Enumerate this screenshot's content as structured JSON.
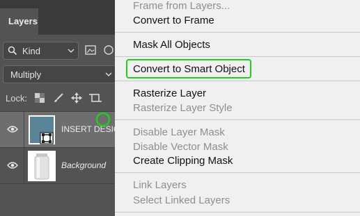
{
  "panel": {
    "tab_label": "Layers",
    "filter": {
      "selected": "Kind"
    },
    "blend_mode": {
      "selected": "Multiply"
    },
    "lock_label": "Lock:",
    "layers": [
      {
        "name": "INSERT DESIG",
        "selected": true
      },
      {
        "name": "Background",
        "selected": false
      }
    ]
  },
  "menu": {
    "items": [
      {
        "label": "Frame from Layers...",
        "enabled": false
      },
      {
        "label": "Convert to Frame",
        "enabled": true
      },
      {
        "label": "Mask All Objects",
        "enabled": true
      },
      {
        "label": "Convert to Smart Object",
        "enabled": true,
        "highlighted": true
      },
      {
        "label": "Rasterize Layer",
        "enabled": true
      },
      {
        "label": "Rasterize Layer Style",
        "enabled": false
      },
      {
        "label": "Disable Layer Mask",
        "enabled": false
      },
      {
        "label": "Disable Vector Mask",
        "enabled": false
      },
      {
        "label": "Create Clipping Mask",
        "enabled": true
      },
      {
        "label": "Link Layers",
        "enabled": false
      },
      {
        "label": "Select Linked Layers",
        "enabled": false
      }
    ]
  },
  "colors": {
    "highlight_outline": "#1fcf1f",
    "thumbnail_fill": "#5a8498",
    "panel_bg": "#535353",
    "menu_bg": "#f0f0f0"
  }
}
